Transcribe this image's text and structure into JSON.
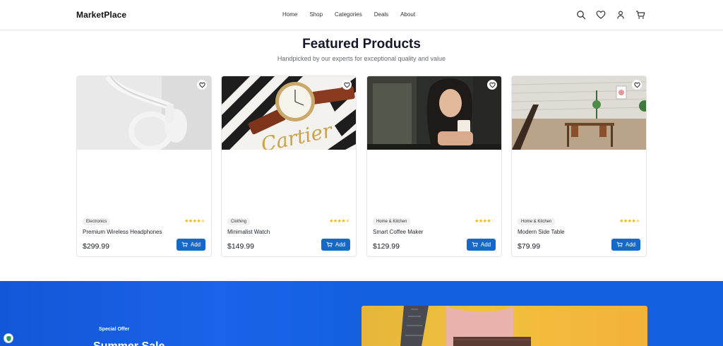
{
  "header": {
    "logo": "MarketPlace",
    "nav": [
      "Home",
      "Shop",
      "Categories",
      "Deals",
      "About"
    ],
    "icons": [
      "search-icon",
      "heart-icon",
      "user-icon",
      "cart-icon"
    ]
  },
  "featured": {
    "title": "Featured Products",
    "subtitle": "Handpicked by our experts for exceptional quality and value",
    "products": [
      {
        "name": "Premium Wireless Headphones",
        "category": "Electronics",
        "price": "$299.99",
        "rating": 4.5,
        "add_label": "Add"
      },
      {
        "name": "Minimalist Watch",
        "category": "Clothing",
        "price": "$149.99",
        "rating": 4.5,
        "add_label": "Add"
      },
      {
        "name": "Smart Coffee Maker",
        "category": "Home & Kitchen",
        "price": "$129.99",
        "rating": 4,
        "add_label": "Add"
      },
      {
        "name": "Modern Side Table",
        "category": "Home & Kitchen",
        "price": "$79.99",
        "rating": 4.5,
        "add_label": "Add"
      }
    ],
    "images": [
      "Cartier"
    ]
  },
  "promo": {
    "label": "Special Offer",
    "heading": "Summer Sale"
  },
  "colors": {
    "accent": "#1769c9",
    "promo_bg": "#1360e0",
    "star": "#f2b400"
  }
}
